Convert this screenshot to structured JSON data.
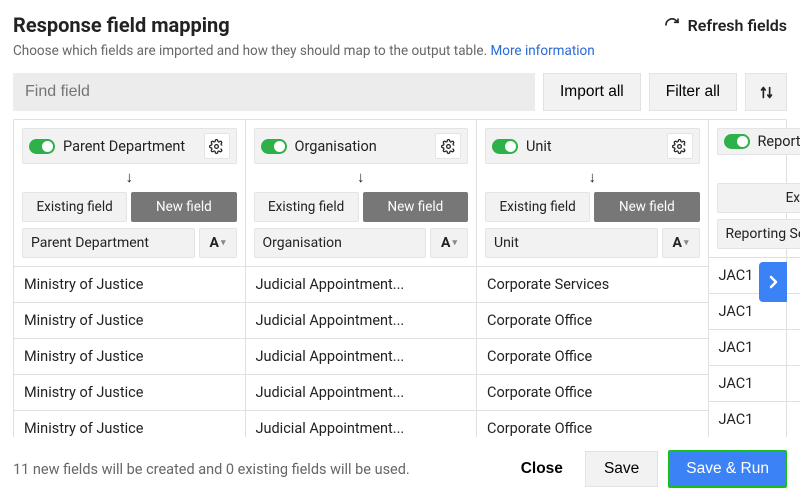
{
  "header": {
    "title": "Response field mapping",
    "refresh_label": "Refresh fields"
  },
  "description": {
    "text": "Choose which fields are imported and how they should map to the output table.",
    "more_info": "More information"
  },
  "toolbar": {
    "find_placeholder": "Find field",
    "import_all": "Import all",
    "filter_all": "Filter all"
  },
  "tabs": {
    "existing": "Existing field",
    "new": "New field"
  },
  "type_glyph": "A",
  "columns": [
    {
      "header": "Parent Department",
      "active_tab": "new",
      "field_name": "Parent Department",
      "has_gear": true,
      "rows": [
        "Ministry of Justice",
        "Ministry of Justice",
        "Ministry of Justice",
        "Ministry of Justice",
        "Ministry of Justice"
      ]
    },
    {
      "header": "Organisation",
      "active_tab": "new",
      "field_name": "Organisation",
      "has_gear": true,
      "rows": [
        "Judicial Appointment...",
        "Judicial Appointment...",
        "Judicial Appointment...",
        "Judicial Appointment...",
        "Judicial Appointment..."
      ]
    },
    {
      "header": "Unit",
      "active_tab": "new",
      "field_name": "Unit",
      "has_gear": true,
      "rows": [
        "Corporate Services",
        "Corporate Office",
        "Corporate Office",
        "Corporate Office",
        "Corporate Office"
      ]
    },
    {
      "header": "Reporting Seni",
      "active_tab": "existing",
      "field_name": "Reporting Senior F",
      "has_gear": false,
      "rows": [
        "JAC1",
        "JAC1",
        "JAC1",
        "JAC1",
        "JAC1"
      ]
    }
  ],
  "footer": {
    "status": "11 new fields will be created and 0 existing fields will be used.",
    "close": "Close",
    "save": "Save",
    "save_run": "Save & Run"
  }
}
